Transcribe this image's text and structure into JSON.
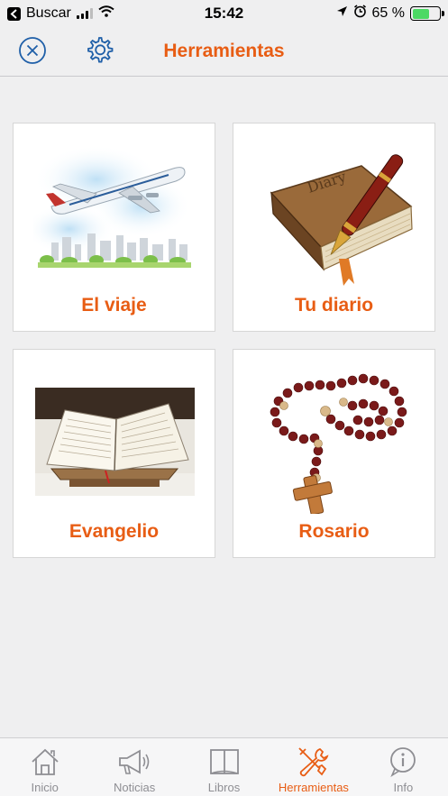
{
  "status_bar": {
    "back_label": "Buscar",
    "time": "15:42",
    "battery_percent": "65 %",
    "battery_level": 0.65
  },
  "nav": {
    "title": "Herramientas"
  },
  "tiles": [
    {
      "label": "El viaje",
      "icon": "airplane-city-icon"
    },
    {
      "label": "Tu diario",
      "icon": "diary-pen-icon"
    },
    {
      "label": "Evangelio",
      "icon": "open-book-lectern-icon"
    },
    {
      "label": "Rosario",
      "icon": "rosary-icon"
    }
  ],
  "tabs": [
    {
      "label": "Inicio",
      "icon": "home-icon",
      "active": false
    },
    {
      "label": "Noticias",
      "icon": "megaphone-icon",
      "active": false
    },
    {
      "label": "Libros",
      "icon": "book-icon",
      "active": false
    },
    {
      "label": "Herramientas",
      "icon": "tools-icon",
      "active": true
    },
    {
      "label": "Info",
      "icon": "info-icon",
      "active": false
    }
  ],
  "colors": {
    "accent": "#e85d14",
    "icon_blue": "#1f5fa8",
    "inactive": "#8e8e93",
    "background": "#efeff0"
  }
}
